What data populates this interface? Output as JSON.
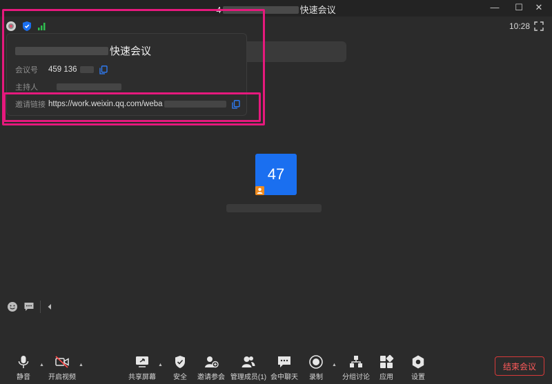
{
  "window": {
    "title_prefix": "4",
    "title_suffix": "快速会议",
    "minimize_glyph": "—",
    "maximize_glyph": "☐",
    "close_glyph": "✕"
  },
  "status": {
    "time": "10:28"
  },
  "meeting_info": {
    "title_suffix": "快速会议",
    "rows": {
      "meeting_id": {
        "label": "会议号",
        "value": "459 136"
      },
      "host": {
        "label": "主持人",
        "value": ""
      },
      "invite_link": {
        "label": "邀请链接",
        "value": "https://work.weixin.qq.com/weba"
      }
    }
  },
  "participant": {
    "avatar_text": "47"
  },
  "toolbar": {
    "mute": "静音",
    "video": "开启视频",
    "share": "共享屏幕",
    "security": "安全",
    "invite": "邀请参会",
    "members": "管理成员(1)",
    "chat": "会中聊天",
    "record": "录制",
    "breakout": "分组讨论",
    "apps": "应用",
    "settings": "设置",
    "end": "结束会议"
  },
  "colors": {
    "accent": "#1a6ff0",
    "highlight": "#e6197d",
    "end": "#d83a3a",
    "signal": "#2fbf4f"
  }
}
